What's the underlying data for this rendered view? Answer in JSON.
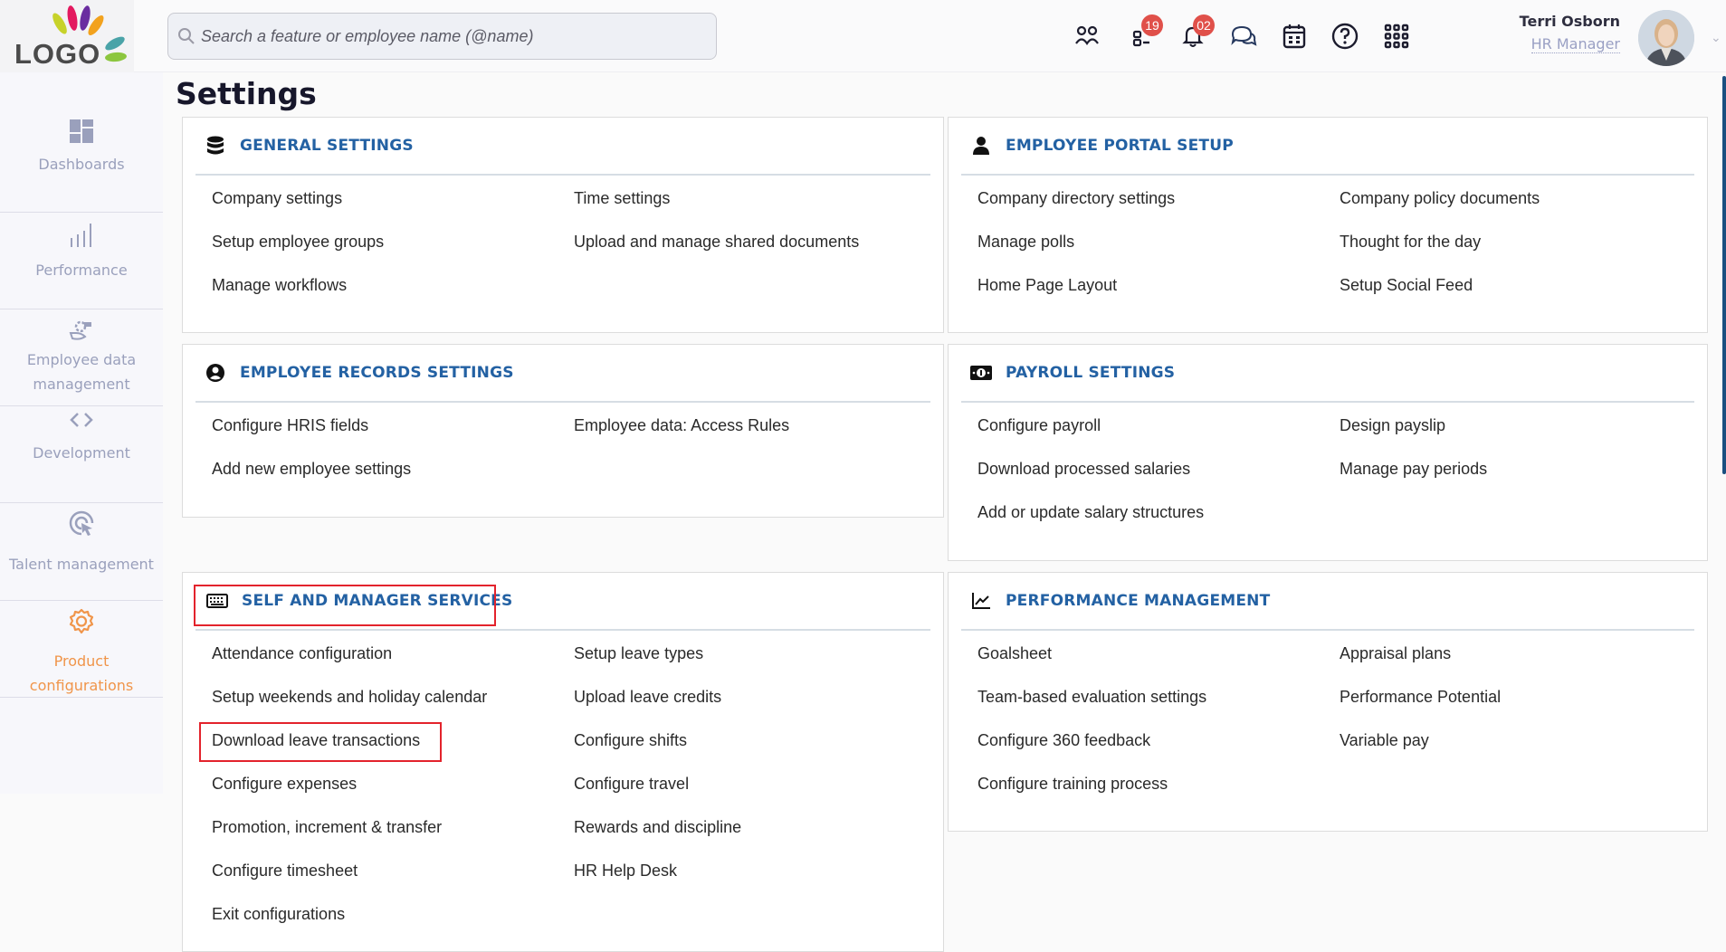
{
  "header": {
    "logo_text": "LOGO",
    "search_placeholder": "Search a feature or employee name (@name)",
    "icons": [
      {
        "name": "people-icon"
      },
      {
        "name": "tasks-icon",
        "badge": "19"
      },
      {
        "name": "bell-icon",
        "badge": "02"
      },
      {
        "name": "chat-icon"
      },
      {
        "name": "calendar-icon"
      },
      {
        "name": "help-icon"
      },
      {
        "name": "apps-grid-icon"
      }
    ],
    "user": {
      "name": "Terri Osborn",
      "role": "HR Manager"
    }
  },
  "sidebar": {
    "items": [
      {
        "label": "Dashboards",
        "icon": "dashboard-icon",
        "active": false
      },
      {
        "label": "Performance",
        "icon": "bar-chart-icon",
        "active": false
      },
      {
        "label": "Employee data management",
        "icon": "hand-gear-icon",
        "active": false
      },
      {
        "label": "Development",
        "icon": "code-icon",
        "active": false
      },
      {
        "label": "Talent management",
        "icon": "target-cursor-icon",
        "active": false
      },
      {
        "label": "Product configurations",
        "icon": "gear-icon",
        "active": true
      }
    ]
  },
  "page": {
    "title": "Settings",
    "sections": [
      {
        "title": "GENERAL SETTINGS",
        "icon": "database-icon",
        "items": [
          "Company settings",
          "Time settings",
          "Setup employee groups",
          "Upload and manage shared documents",
          "Manage workflows"
        ]
      },
      {
        "title": "EMPLOYEE PORTAL SETUP",
        "icon": "user-icon",
        "items": [
          "Company directory settings",
          "Company policy documents",
          "Manage polls",
          "Thought for the day",
          "Home Page Layout",
          "Setup Social Feed"
        ]
      },
      {
        "title": "EMPLOYEE RECORDS SETTINGS",
        "icon": "user-circle-icon",
        "items": [
          "Configure HRIS fields",
          "Employee data: Access Rules",
          "Add new employee settings"
        ]
      },
      {
        "title": "PAYROLL SETTINGS",
        "icon": "money-icon",
        "items": [
          "Configure payroll",
          "Design payslip",
          "Download processed salaries",
          "Manage pay periods",
          "Add or update salary structures"
        ]
      },
      {
        "title": "SELF AND MANAGER SERVICES",
        "icon": "keyboard-icon",
        "highlighted": true,
        "items": [
          "Attendance configuration",
          "Setup leave types",
          "Setup weekends and holiday calendar",
          "Upload leave credits",
          "Download leave transactions",
          "Configure shifts",
          "Configure expenses",
          "Configure travel",
          "Promotion, increment & transfer",
          "Rewards and discipline",
          "Configure timesheet",
          "HR Help Desk",
          "Exit configurations"
        ],
        "highlighted_item": "Download leave transactions"
      },
      {
        "title": "PERFORMANCE MANAGEMENT",
        "icon": "line-chart-icon",
        "items": [
          "Goalsheet",
          "Appraisal plans",
          "Team-based evaluation settings",
          "Performance Potential",
          "Configure 360 feedback",
          "Variable pay",
          "Configure training process"
        ]
      }
    ]
  },
  "colors": {
    "accent": "#2361a3",
    "active_sidebar": "#f0954a",
    "badge": "#e0504a",
    "highlight_box": "#e3232c",
    "scrollbar": "#1a4f80"
  }
}
